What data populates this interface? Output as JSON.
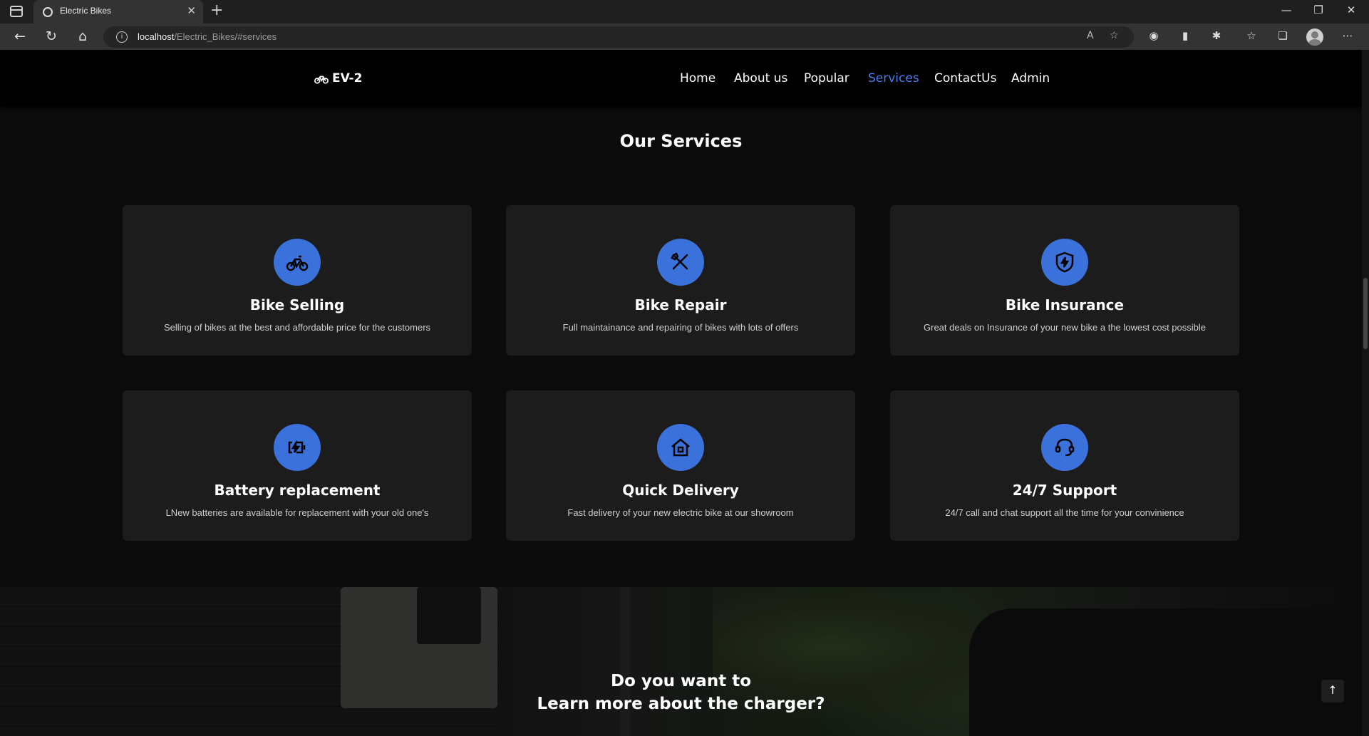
{
  "browser": {
    "tab_title": "Electric Bikes",
    "tab_close": "✕",
    "new_tab": "+",
    "url_host": "localhost",
    "url_path": "/Electric_Bikes/#services",
    "window_controls": {
      "minimize": "—",
      "restore": "❐",
      "close": "✕"
    },
    "nav_icons": {
      "back": "←",
      "reload": "↻",
      "home": "⌂"
    }
  },
  "site": {
    "logo_text": "EV-2",
    "nav": [
      "Home",
      "About us",
      "Popular",
      "Services",
      "ContactUs",
      "Admin"
    ],
    "active_nav": "Services",
    "accent_color": "#3b71db",
    "active_color": "#4a7fe8"
  },
  "services": {
    "title": "Our Services",
    "items": [
      {
        "icon": "motorbike-icon",
        "title": "Bike Selling",
        "desc": "Selling of bikes at the best and affordable price for the customers"
      },
      {
        "icon": "tools-icon",
        "title": "Bike Repair",
        "desc": "Full maintainance and repairing of bikes with lots of offers"
      },
      {
        "icon": "shield-bolt-icon",
        "title": "Bike Insurance",
        "desc": "Great deals on Insurance of your new bike a the lowest cost possible"
      },
      {
        "icon": "battery-charge-icon",
        "title": "Battery replacement",
        "desc": "LNew batteries are available for replacement with your old one's"
      },
      {
        "icon": "home-delivery-icon",
        "title": "Quick Delivery",
        "desc": "Fast delivery of your new electric bike at our showroom"
      },
      {
        "icon": "headset-icon",
        "title": "24/7 Support",
        "desc": "24/7 call and chat support all the time for your convinience"
      }
    ]
  },
  "banner": {
    "line1": "Do you want to",
    "line2": "Learn more about the charger?"
  },
  "scroll_top_label": "↑"
}
